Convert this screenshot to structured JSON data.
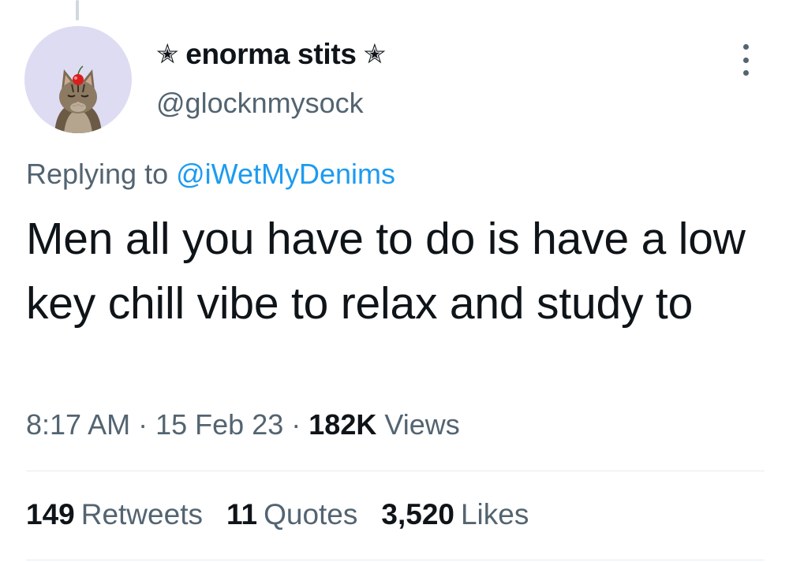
{
  "author": {
    "display_name": "enorma stits",
    "star_left": "✭",
    "star_right": "✭",
    "handle": "@glocknmysock",
    "avatar_icon": "cat-with-cherry-avatar"
  },
  "reply": {
    "prefix": "Replying to",
    "mention": "@iWetMyDenims"
  },
  "tweet": {
    "text": "Men all you have to do is have a low key chill vibe to relax and study to"
  },
  "meta": {
    "time": "8:17 AM",
    "separator": "·",
    "date": "15 Feb 23",
    "views_count": "182K",
    "views_label": "Views"
  },
  "stats": [
    {
      "count": "149",
      "label": "Retweets"
    },
    {
      "count": "11",
      "label": "Quotes"
    },
    {
      "count": "3,520",
      "label": "Likes"
    }
  ],
  "colors": {
    "text": "#0f1419",
    "secondary": "#536471",
    "link": "#1d9bf0",
    "avatar_bg": "#dedcf3"
  }
}
